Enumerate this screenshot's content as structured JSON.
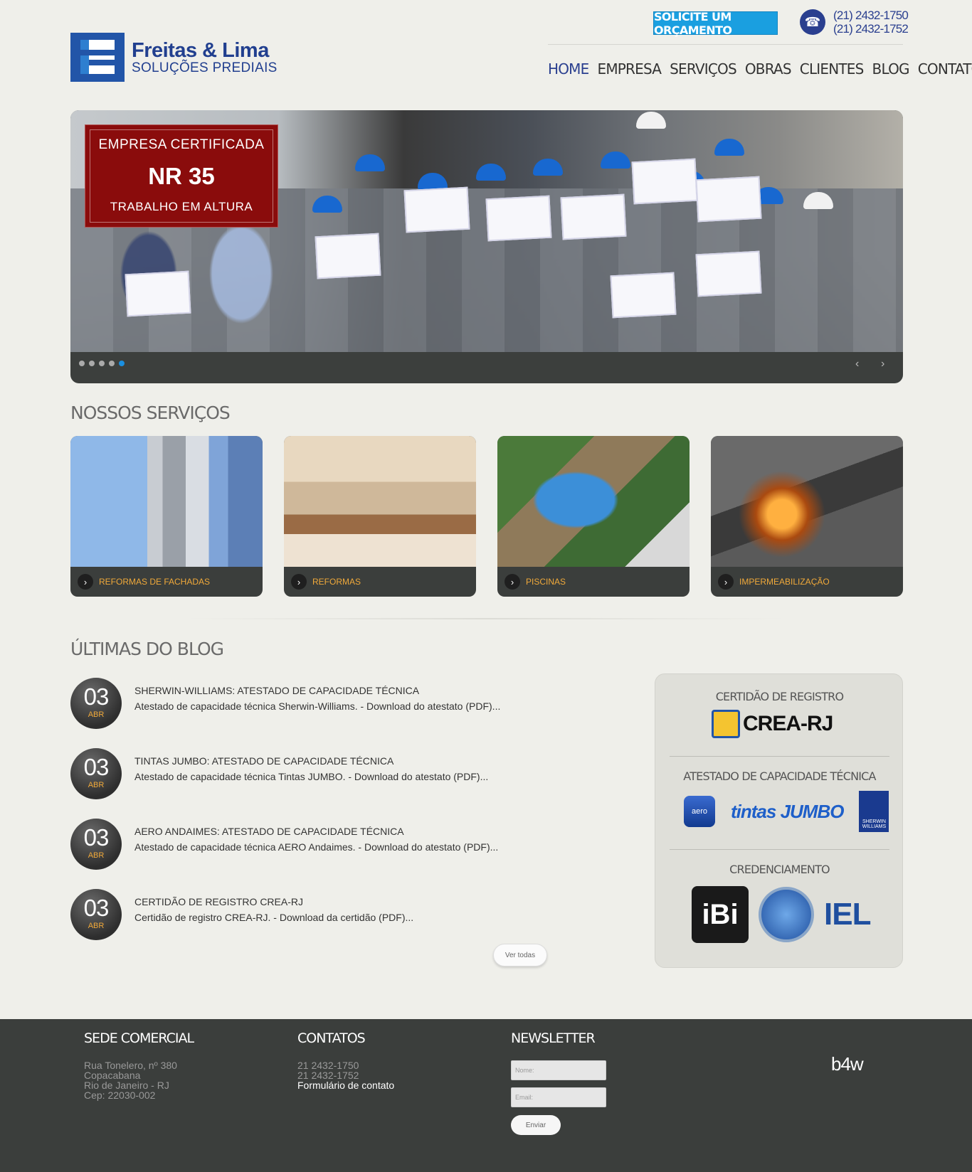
{
  "header": {
    "logo_name": "Freitas & Lima",
    "logo_sub": "SOLUÇÕES PREDIAIS",
    "quote_button": "SOLICITE UM ORÇAMENTO",
    "phone1": "(21) 2432-1750",
    "phone2": "(21) 2432-1752"
  },
  "nav": {
    "items": [
      "HOME",
      "EMPRESA",
      "SERVIÇOS",
      "OBRAS",
      "CLIENTES",
      "BLOG",
      "CONTATOS"
    ],
    "active": "HOME"
  },
  "slider": {
    "badge_line1": "EMPRESA CERTIFICADA",
    "badge_line2": "NR 35",
    "badge_line3": "TRABALHO EM ALTURA",
    "dots_count": 5,
    "active_dot": 5,
    "prev_arrow": "‹",
    "next_arrow": "›"
  },
  "services": {
    "title": "NOSSOS SERVIÇOS",
    "items": [
      "REFORMAS DE FACHADAS",
      "REFORMAS",
      "PISCINAS",
      "IMPERMEABILIZAÇÃO"
    ]
  },
  "blog": {
    "title": "ÚLTIMAS DO BLOG",
    "posts": [
      {
        "day": "03",
        "month": "ABR",
        "title": "SHERWIN-WILLIAMS: ATESTADO DE CAPACIDADE TÉCNICA",
        "excerpt": "Atestado de capacidade técnica Sherwin-Williams. - Download do atestato (PDF)..."
      },
      {
        "day": "03",
        "month": "ABR",
        "title": "TINTAS JUMBO: ATESTADO DE CAPACIDADE TÉCNICA",
        "excerpt": "Atestado de capacidade técnica Tintas JUMBO. - Download do atestato (PDF)..."
      },
      {
        "day": "03",
        "month": "ABR",
        "title": "AERO ANDAIMES: ATESTADO DE CAPACIDADE TÉCNICA",
        "excerpt": "Atestado de capacidade técnica AERO Andaimes. - Download do atestato (PDF)..."
      },
      {
        "day": "03",
        "month": "ABR",
        "title": "CERTIDÃO DE REGISTRO CREA-RJ",
        "excerpt": "Certidão de registro CREA-RJ. - Download da certidão (PDF)..."
      }
    ],
    "see_all": "Ver todas"
  },
  "sidebar": {
    "cert_title": "CERTIDÃO DE REGISTRO",
    "crea_logo": "CREA-RJ",
    "atestado_title": "ATESTADO DE CAPACIDADE TÉCNICA",
    "aero_logo": "aero",
    "jumbo_logo": "tintas JUMBO",
    "sw_logo": "SHERWIN WILLIAMS",
    "cred_title": "CREDENCIAMENTO",
    "ibi_logo": "iBi",
    "iel_logo": "IEL"
  },
  "footer": {
    "sede_title": "SEDE COMERCIAL",
    "address": [
      "Rua Tonelero, nº 380",
      "Copacabana",
      "Rio de Janeiro - RJ",
      "Cep: 22030-002"
    ],
    "contacts_title": "CONTATOS",
    "contact_phone1": "21 2432-1750",
    "contact_phone2": "21 2432-1752",
    "contact_link": "Formulário de contato",
    "newsletter_title": "NEWSLETTER",
    "name_placeholder": "Nome:",
    "email_placeholder": "Email:",
    "send_button": "Enviar",
    "credit": "b4w"
  }
}
